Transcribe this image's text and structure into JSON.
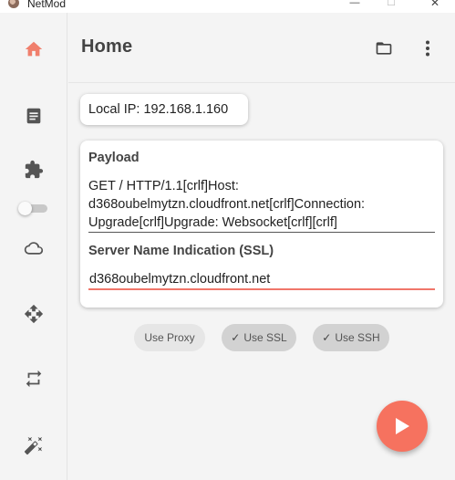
{
  "window": {
    "title": "NetMod",
    "minimize": "—",
    "maximize": "☐",
    "close": "✕"
  },
  "sidebar": {
    "items": [
      {
        "name": "home-icon",
        "active": true
      },
      {
        "name": "document-icon"
      },
      {
        "name": "puzzle-icon"
      },
      {
        "name": "cloud-icon"
      },
      {
        "name": "move-arrows-icon"
      },
      {
        "name": "repeat-icon"
      },
      {
        "name": "magic-wand-icon"
      }
    ],
    "toggle_on": false
  },
  "header": {
    "title": "Home"
  },
  "local_ip": {
    "text": "Local IP: 192.168.1.160"
  },
  "payload": {
    "label": "Payload",
    "line1": "GET / HTTP/1.1[crlf]Host:",
    "line2": "d368oubelmytzn.cloudfront.net[crlf]Connection:",
    "line3": "Upgrade[crlf]Upgrade: Websocket[crlf][crlf]"
  },
  "sni": {
    "label": "Server Name Indication (SSL)",
    "value": "d368oubelmytzn.cloudfront.net"
  },
  "chips": {
    "proxy": {
      "label": "Use Proxy",
      "selected": false
    },
    "ssl": {
      "label": "Use SSL",
      "selected": true,
      "check": "✓"
    },
    "ssh": {
      "label": "Use SSH",
      "selected": true,
      "check": "✓"
    }
  },
  "colors": {
    "accent": "#f6725f",
    "active_icon": "#f07f6c",
    "icon": "#555555"
  }
}
